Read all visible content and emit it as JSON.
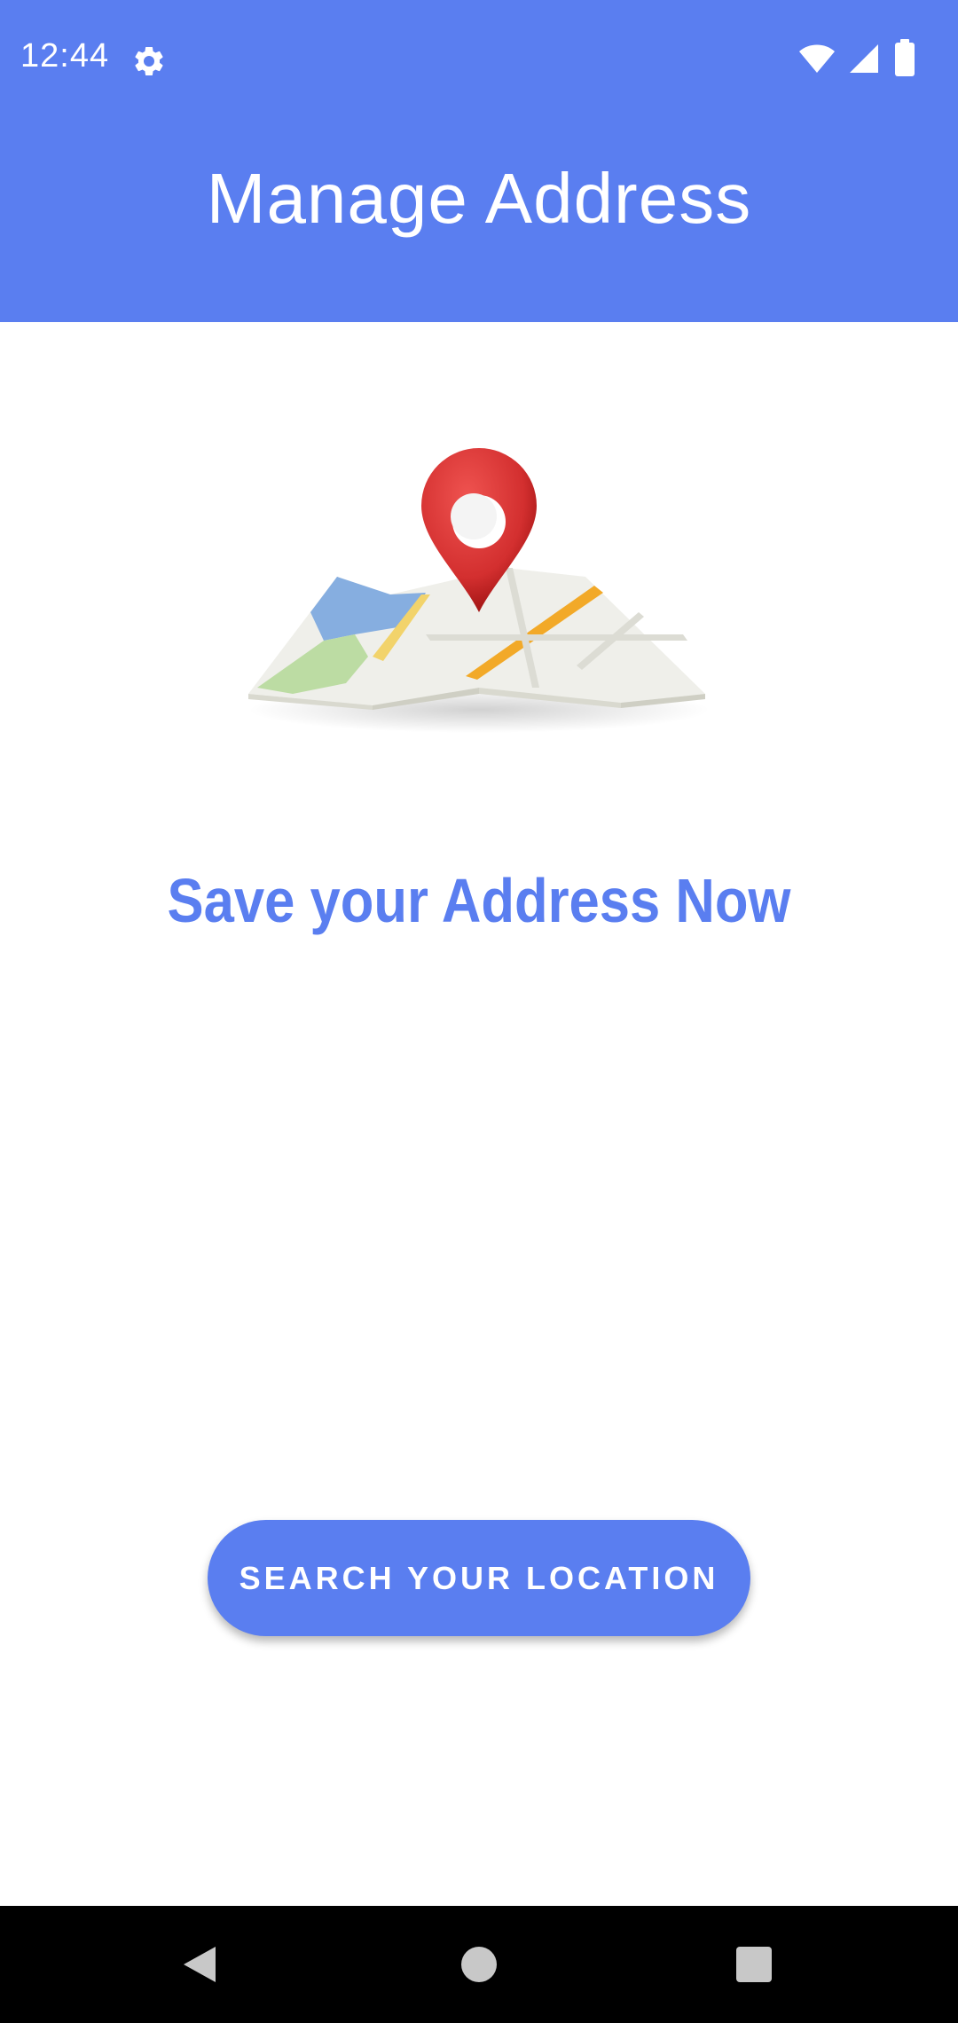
{
  "status_bar": {
    "time": "12:44",
    "icons": [
      "gear-icon",
      "wifi-icon",
      "signal-icon",
      "battery-icon"
    ]
  },
  "header": {
    "title": "Manage Address"
  },
  "hero": {
    "image": "map-pin-illustration"
  },
  "main": {
    "headline": "Save your Address Now",
    "search_button_label": "SEARCH YOUR LOCATION"
  },
  "nav_bar": {
    "icons": [
      "back-icon",
      "home-icon",
      "recents-icon"
    ]
  },
  "colors": {
    "primary": "#5a7ef0",
    "background": "#ffffff",
    "nav_bar": "#000000",
    "pin": "#d32f2f"
  }
}
